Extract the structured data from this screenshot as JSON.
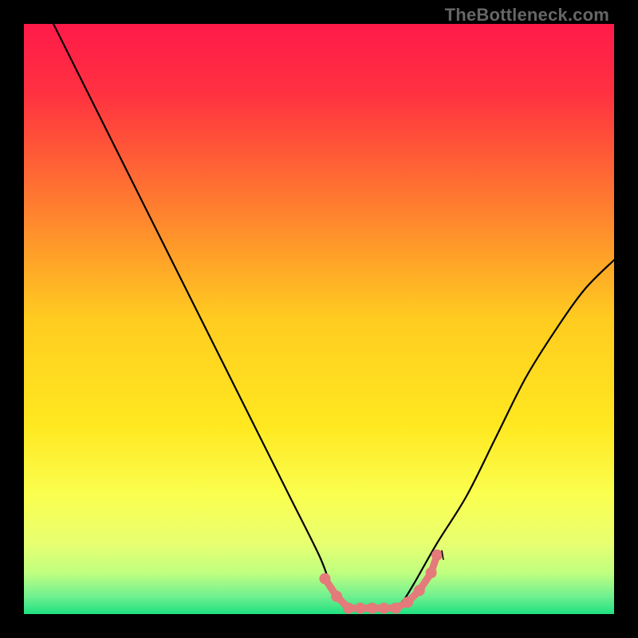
{
  "watermark": "TheBottleneck.com",
  "colors": {
    "frame": "#000000",
    "curve": "#000000",
    "marker_stroke": "#e47a7a",
    "marker_fill": "#e47a7a",
    "gradient_stops": [
      {
        "offset": 0.0,
        "color": "#ff1a4a"
      },
      {
        "offset": 0.12,
        "color": "#ff3240"
      },
      {
        "offset": 0.3,
        "color": "#ff7a30"
      },
      {
        "offset": 0.5,
        "color": "#ffcc20"
      },
      {
        "offset": 0.68,
        "color": "#ffe820"
      },
      {
        "offset": 0.8,
        "color": "#faff50"
      },
      {
        "offset": 0.88,
        "color": "#e8ff70"
      },
      {
        "offset": 0.93,
        "color": "#c0ff80"
      },
      {
        "offset": 0.97,
        "color": "#70f090"
      },
      {
        "offset": 1.0,
        "color": "#20e080"
      }
    ]
  },
  "chart_data": {
    "type": "line",
    "title": "",
    "xlabel": "",
    "ylabel": "",
    "xlim": [
      0,
      100
    ],
    "ylim": [
      0,
      100
    ],
    "series": [
      {
        "name": "bottleneck-curve",
        "x": [
          5,
          10,
          15,
          20,
          25,
          30,
          35,
          40,
          45,
          50,
          52,
          54,
          56,
          58,
          60,
          62,
          64,
          66,
          70,
          75,
          80,
          85,
          90,
          95,
          100
        ],
        "values": [
          100,
          90,
          80,
          70,
          60,
          50,
          40,
          30,
          20,
          10,
          5,
          2,
          1,
          1,
          1,
          1,
          2,
          5,
          12,
          20,
          30,
          40,
          48,
          55,
          60
        ]
      }
    ],
    "annotations": [
      {
        "name": "valley-marker-region",
        "type": "dotted-segment",
        "x": [
          51,
          53,
          55,
          57,
          59,
          61,
          63,
          65,
          67,
          69,
          70
        ],
        "values": [
          6,
          3,
          1,
          1,
          1,
          1,
          1,
          2,
          4,
          7,
          10
        ]
      }
    ]
  }
}
